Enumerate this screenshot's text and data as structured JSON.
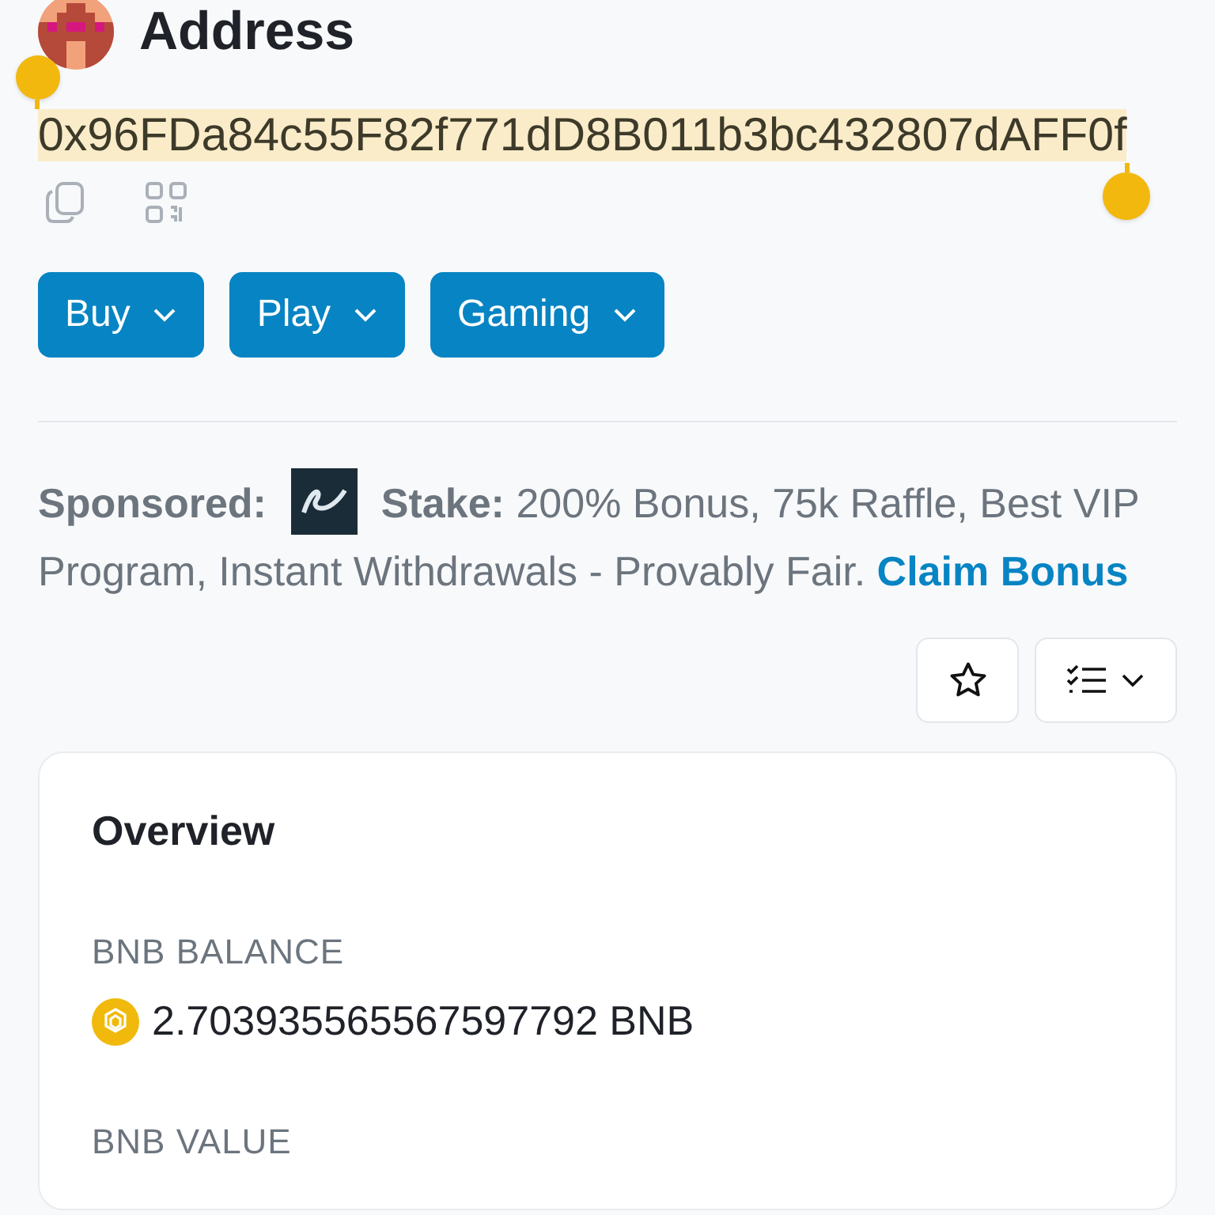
{
  "header": {
    "title": "Address"
  },
  "address": {
    "text": "0x96FDa84c55F82f771dD8B011b3bc432807dAFF0f",
    "selected": true
  },
  "menus": [
    {
      "label": "Buy"
    },
    {
      "label": "Play"
    },
    {
      "label": "Gaming"
    }
  ],
  "sponsored": {
    "label": "Sponsored:",
    "text": "**Stake:** 200% Bonus, 75k Raffle, Best VIP Program, Instant Withdrawals - Provably Fair.",
    "link": "Claim Bonus"
  },
  "overview": {
    "title": "Overview",
    "fields": [
      {
        "label": "BNB BALANCE",
        "value": "2.703935565567597792 BNB"
      },
      {
        "label": "BNB VALUE"
      }
    ]
  }
}
